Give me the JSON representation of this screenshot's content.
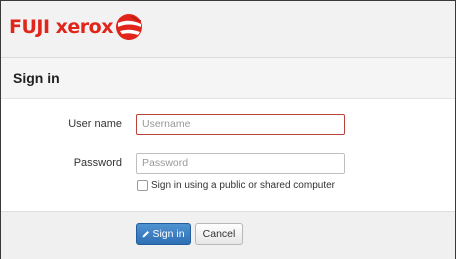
{
  "brand": {
    "name": "FUJI xerox",
    "accent_color": "#e1251b"
  },
  "page": {
    "title": "Sign in"
  },
  "form": {
    "username_label": "User name",
    "username_placeholder": "Username",
    "password_label": "Password",
    "password_placeholder": "Password",
    "public_computer_label": "Sign in using a public or shared computer",
    "public_computer_checked": false
  },
  "actions": {
    "sign_in_label": "Sign in",
    "sign_in_icon": "pencil-icon",
    "cancel_label": "Cancel"
  }
}
